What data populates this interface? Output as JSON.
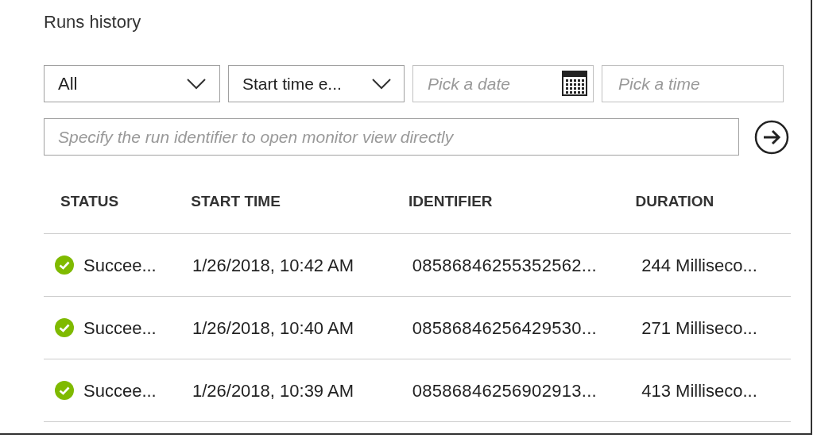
{
  "title": "Runs history",
  "filters": {
    "status": {
      "value": "All"
    },
    "sort": {
      "value": "Start time e..."
    },
    "date": {
      "placeholder": "Pick a date"
    },
    "time": {
      "placeholder": "Pick a time"
    }
  },
  "run_search": {
    "placeholder": "Specify the run identifier to open monitor view directly"
  },
  "table": {
    "columns": [
      "STATUS",
      "START TIME",
      "IDENTIFIER",
      "DURATION"
    ],
    "rows": [
      {
        "status": "Succee...",
        "kind": "succeeded",
        "start_time": "1/26/2018, 10:42 AM",
        "identifier": "08586846255352562...",
        "duration": "244 Milliseco..."
      },
      {
        "status": "Succee...",
        "kind": "succeeded",
        "start_time": "1/26/2018, 10:40 AM",
        "identifier": "08586846256429530...",
        "duration": "271 Milliseco..."
      },
      {
        "status": "Succee...",
        "kind": "succeeded",
        "start_time": "1/26/2018, 10:39 AM",
        "identifier": "08586846256902913...",
        "duration": "413 Milliseco..."
      }
    ]
  }
}
